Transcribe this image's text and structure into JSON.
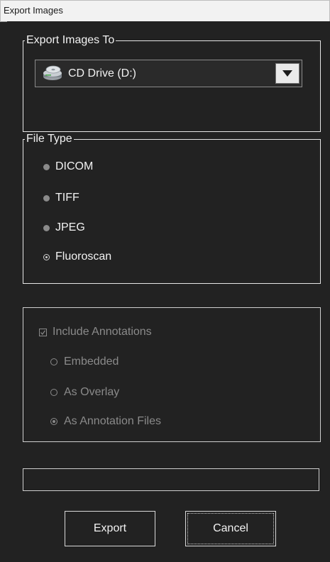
{
  "window": {
    "title": "Export Images"
  },
  "export_to": {
    "legend": "Export Images To",
    "selected_drive": "CD Drive (D:)",
    "drive_icon": "cd-drive-icon",
    "dropdown_icon": "chevron-down-icon"
  },
  "file_type": {
    "legend": "File Type",
    "options": [
      {
        "label": "DICOM",
        "selected": false
      },
      {
        "label": "TIFF",
        "selected": false
      },
      {
        "label": "JPEG",
        "selected": false
      },
      {
        "label": "Fluoroscan",
        "selected": true
      }
    ]
  },
  "annotations": {
    "include_label": "Include Annotations",
    "include_checked": true,
    "enabled": false,
    "options": [
      {
        "label": "Embedded",
        "selected": false
      },
      {
        "label": "As Overlay",
        "selected": false
      },
      {
        "label": "As Annotation Files",
        "selected": true
      }
    ]
  },
  "status": {
    "text": ""
  },
  "buttons": {
    "export": "Export",
    "cancel": "Cancel"
  },
  "colors": {
    "background": "#222222",
    "text": "#f2f2f2",
    "disabled_text": "#8a8a8a",
    "titlebar": "#f2f2f2"
  }
}
